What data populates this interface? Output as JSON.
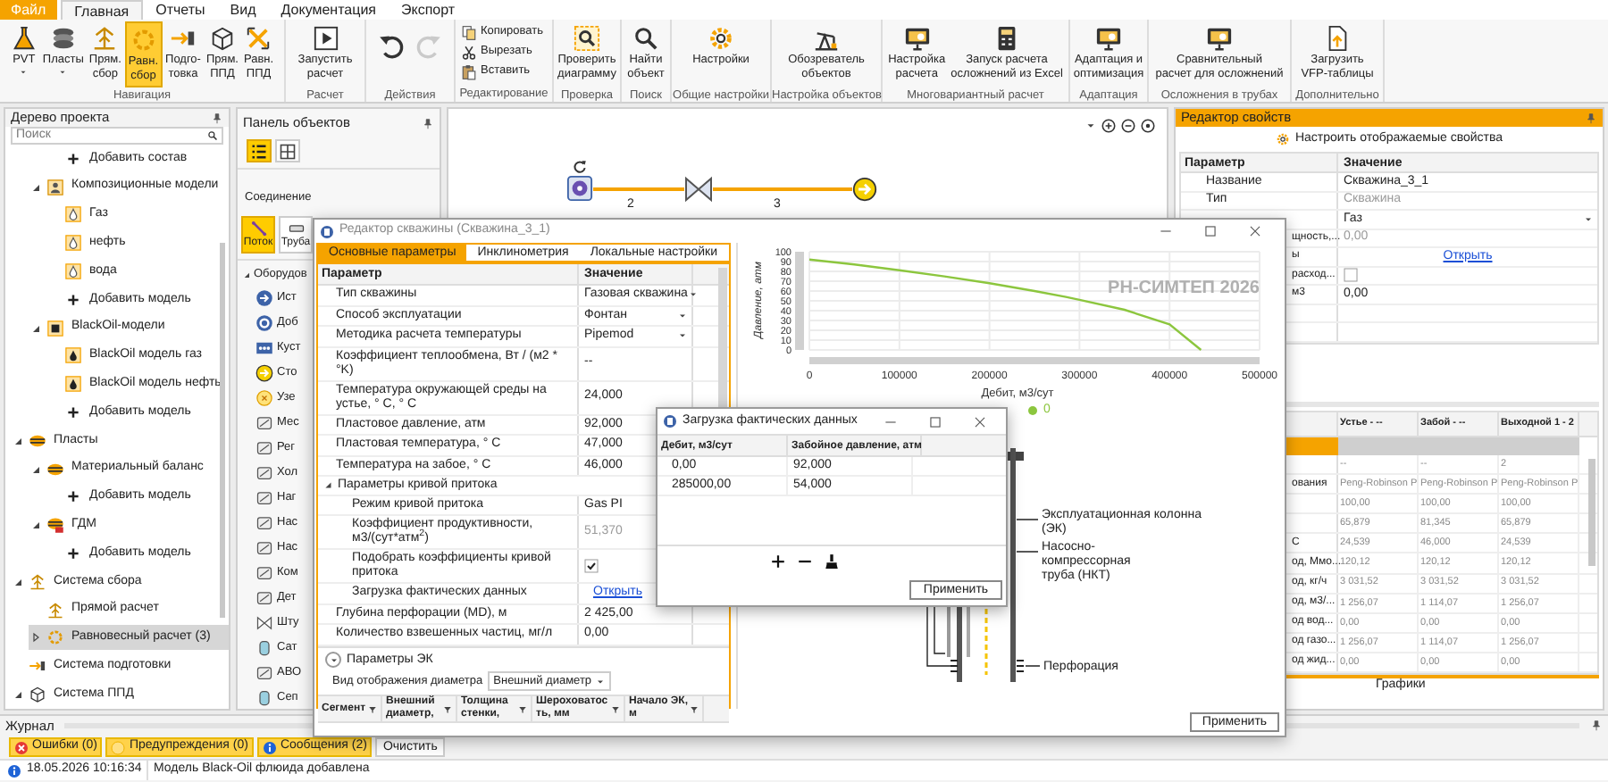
{
  "menu_tabs": [
    {
      "label": "Файл",
      "kind": "file",
      "selected": false
    },
    {
      "label": "Главная",
      "kind": "tab",
      "selected": true
    },
    {
      "label": "Отчеты",
      "kind": "tab",
      "selected": false
    },
    {
      "label": "Вид",
      "kind": "tab",
      "selected": false
    },
    {
      "label": "Документация",
      "kind": "tab",
      "selected": false
    },
    {
      "label": "Экспорт",
      "kind": "tab",
      "selected": false
    }
  ],
  "ribbon": [
    {
      "label": "Навигация",
      "kind": "large",
      "buttons": [
        {
          "label": "PVT",
          "kind": "flask",
          "dropdown": true,
          "selected": false
        },
        {
          "label": "Пласты",
          "kind": "layers",
          "dropdown": true,
          "selected": false
        },
        {
          "label": "Прям.\nсбор",
          "kind": "tower",
          "selected": false
        },
        {
          "label": "Равн.\nсбор",
          "kind": "ring",
          "selected": true
        },
        {
          "label": "Подго-\nтовка",
          "kind": "arrows",
          "selected": false
        },
        {
          "label": "Прям.\nППД",
          "kind": "cube",
          "selected": false
        },
        {
          "label": "Равн.\nППД",
          "kind": "cross",
          "selected": false
        }
      ]
    },
    {
      "label": "Расчет",
      "kind": "large",
      "buttons": [
        {
          "label": "Запустить\nрасчет",
          "kind": "play"
        }
      ]
    },
    {
      "label": "Действия",
      "kind": "large",
      "buttons": [
        {
          "kind": "undo",
          "disabled": false
        },
        {
          "kind": "redo",
          "disabled": true
        }
      ]
    },
    {
      "label": "Редактирование",
      "kind": "small",
      "buttons": [
        {
          "label": "Копировать",
          "kind": "copy"
        },
        {
          "label": "Вырезать",
          "kind": "cut"
        },
        {
          "label": "Вставить",
          "kind": "paste"
        }
      ]
    },
    {
      "label": "Проверка",
      "kind": "large",
      "buttons": [
        {
          "label": "Проверить\nдиаграмму",
          "kind": "check"
        }
      ]
    },
    {
      "label": "Поиск",
      "kind": "large",
      "buttons": [
        {
          "label": "Найти\nобъект",
          "kind": "search"
        }
      ]
    },
    {
      "label": "Общие настройки",
      "kind": "large",
      "buttons": [
        {
          "label": "Настройки",
          "kind": "gear"
        }
      ]
    },
    {
      "label": "Настройка объектов",
      "kind": "large",
      "buttons": [
        {
          "label": "Обозреватель\nобъектов",
          "kind": "rig"
        }
      ]
    },
    {
      "label": "Многовариантный расчет",
      "kind": "large",
      "buttons": [
        {
          "label": "Настройка\nрасчета",
          "kind": "monitor"
        },
        {
          "label": "Запуск расчета\nосложнений из Excel",
          "kind": "calc"
        }
      ]
    },
    {
      "label": "Адаптация",
      "kind": "large",
      "buttons": [
        {
          "label": "Адаптация и\nоптимизация",
          "kind": "monitor"
        }
      ]
    },
    {
      "label": "Осложнения в трубах",
      "kind": "large",
      "buttons": [
        {
          "label": "Сравнительный\nрасчет для осложнений",
          "kind": "monitor"
        }
      ]
    },
    {
      "label": "Дополнительно",
      "kind": "large",
      "buttons": [
        {
          "label": "Загрузить\nVFP-таблицы",
          "kind": "upload"
        }
      ]
    }
  ],
  "project_tree": {
    "title": "Дерево проекта",
    "search_placeholder": "Поиск",
    "items": [
      {
        "children": [
          {
            "children": [
              {
                "label": "Добавить состав",
                "kind": "add",
                "selected": false
              }
            ]
          },
          {
            "label": "Композиционные модели",
            "kind": "composition",
            "expanded": true,
            "selected": false,
            "children": [
              {
                "label": "Газ",
                "kind": "drop",
                "selected": false
              },
              {
                "label": "нефть",
                "kind": "drop",
                "selected": false
              },
              {
                "label": "вода",
                "kind": "drop",
                "selected": false
              },
              {
                "label": "Добавить модель",
                "kind": "add",
                "selected": false
              }
            ]
          },
          {
            "label": "BlackOil-модели",
            "kind": "blackoil",
            "expanded": true,
            "selected": false,
            "children": [
              {
                "label": "BlackOil модель газ",
                "kind": "oildrop",
                "selected": false
              },
              {
                "label": "BlackOil модель нефть",
                "kind": "oildrop",
                "selected": false
              },
              {
                "label": "Добавить модель",
                "kind": "add",
                "selected": false
              }
            ]
          }
        ]
      },
      {
        "label": "Пласты",
        "kind": "strata",
        "expanded": true,
        "selected": false,
        "children": [
          {
            "label": "Материальный баланс",
            "kind": "strata",
            "expanded": true,
            "selected": false,
            "children": [
              {
                "label": "Добавить модель",
                "kind": "add",
                "selected": false
              }
            ]
          },
          {
            "label": "ГДМ",
            "kind": "gdm",
            "expanded": true,
            "selected": false,
            "children": [
              {
                "label": "Добавить модель",
                "kind": "add",
                "selected": false
              }
            ]
          }
        ]
      },
      {
        "label": "Система сбора",
        "kind": "tower",
        "expanded": true,
        "selected": false,
        "children": [
          {
            "label": "Прямой расчет",
            "kind": "tower",
            "selected": false
          },
          {
            "label": "Равновесный расчет (3)",
            "kind": "ring",
            "expanded": false,
            "selected": true
          }
        ]
      },
      {
        "label": "Система подготовки",
        "kind": "arrows",
        "selected": false
      },
      {
        "label": "Система ППД",
        "kind": "cube",
        "expanded": true,
        "selected": false
      }
    ]
  },
  "objects_panel": {
    "title": "Панель объектов",
    "view_modes": [
      {
        "kind": "list",
        "selected": true
      },
      {
        "kind": "grid",
        "selected": false
      }
    ],
    "connection_label": "Соединение",
    "connections": [
      {
        "label": "Поток",
        "kind": "flow",
        "selected": true
      },
      {
        "label": "Труба",
        "kind": "pipe",
        "selected": false
      }
    ],
    "group": {
      "label": "Оборудов",
      "expanded": true
    },
    "items": [
      {
        "label": "Ист",
        "kind": "source"
      },
      {
        "label": "Доб",
        "kind": "target"
      },
      {
        "label": "Куст",
        "kind": "cluster"
      },
      {
        "label": "Сто",
        "kind": "sink"
      },
      {
        "label": "Узе",
        "kind": "node"
      },
      {
        "label": "Мес",
        "kind": "device"
      },
      {
        "label": "Рег",
        "kind": "device"
      },
      {
        "label": "Хол",
        "kind": "device"
      },
      {
        "label": "Наг",
        "kind": "device"
      },
      {
        "label": "Нас",
        "kind": "device"
      },
      {
        "label": "Нас",
        "kind": "device"
      },
      {
        "label": "Ком",
        "kind": "device"
      },
      {
        "label": "Дет",
        "kind": "device"
      },
      {
        "label": "Шту",
        "kind": "valve"
      },
      {
        "label": "Сат",
        "kind": "tank"
      },
      {
        "label": "АВО",
        "kind": "device"
      },
      {
        "label": "Сеп",
        "kind": "tank"
      }
    ]
  },
  "canvas": {
    "edges": [
      {
        "label": "2"
      },
      {
        "label": "3"
      }
    ]
  },
  "property_editor": {
    "title": "Редактор свойств",
    "configure": "Настроить отображаемые свойства",
    "columns": [
      "Параметр",
      "Значение"
    ],
    "rows": [
      {
        "label": "Название",
        "value": "Скважина_3_1",
        "kind": "text",
        "disabled": false
      },
      {
        "label": "Тип",
        "value": "Скважина",
        "kind": "text",
        "disabled": true
      },
      {
        "value": "Газ",
        "kind": "dropdown"
      },
      {
        "label": "щность,...",
        "value": "0,00",
        "kind": "text",
        "disabled": true
      },
      {
        "label": "ы",
        "value": "Открыть",
        "kind": "link"
      },
      {
        "label": "расход...",
        "kind": "check",
        "checked": false
      },
      {
        "label": "м3",
        "value": "0,00",
        "kind": "text",
        "disabled": false
      }
    ],
    "results_columns": [
      "Устье - --",
      "Забой - --",
      "Выходной 1 - 2"
    ],
    "results_rows": [
      {
        "cells": [
          "--",
          "--",
          "2"
        ]
      },
      {
        "label": "ования",
        "cells": [
          "Peng-Robinson P",
          "Peng-Robinson P",
          "Peng-Robinson P"
        ]
      },
      {
        "cells": [
          "100,00",
          "100,00",
          "100,00"
        ]
      },
      {
        "cells": [
          "65,879",
          "81,345",
          "65,879"
        ]
      },
      {
        "label": "С",
        "cells": [
          "24,539",
          "46,000",
          "24,539"
        ]
      },
      {
        "label": "од, Ммо...",
        "cells": [
          "120,12",
          "120,12",
          "120,12"
        ]
      },
      {
        "label": "од, кг/ч",
        "cells": [
          "3 031,52",
          "3 031,52",
          "3 031,52"
        ]
      },
      {
        "label": "од, м3/...",
        "cells": [
          "1 256,07",
          "1 114,07",
          "1 256,07"
        ]
      },
      {
        "label": "од вод...",
        "cells": [
          "0,00",
          "0,00",
          "0,00"
        ]
      },
      {
        "label": "од газо...",
        "cells": [
          "1 256,07",
          "1 114,07",
          "1 256,07"
        ]
      },
      {
        "label": "од жид...",
        "cells": [
          "0,00",
          "0,00",
          "0,00"
        ]
      }
    ],
    "bottom_tab": "Графики"
  },
  "journal": {
    "title": "Журнал",
    "filters": [
      {
        "label": "Ошибки (0)",
        "kind": "error",
        "on": true
      },
      {
        "label": "Предупреждения (0)",
        "kind": "warning",
        "on": true
      },
      {
        "label": "Сообщения (2)",
        "kind": "info",
        "on": true
      }
    ],
    "clear_button": "Очистить",
    "entries": [
      {
        "kind": "info",
        "time": "18.05.2026 10:16:34",
        "message": "Модель Black-Oil флюида добавлена"
      }
    ]
  },
  "well_editor": {
    "title": "Редактор скважины (Скважина_3_1)",
    "tabs": [
      {
        "label": "Основные параметры",
        "selected": true
      },
      {
        "label": "Инклинометрия",
        "selected": false
      },
      {
        "label": "Локальные настройки",
        "selected": false
      }
    ],
    "columns": [
      "Параметр",
      "Значение"
    ],
    "params": [
      {
        "label": "Тип скважины",
        "value": "Газовая скважина",
        "kind": "dropdown"
      },
      {
        "label": "Способ эксплуатации",
        "value": "Фонтан",
        "kind": "dropdown"
      },
      {
        "label": "Методика расчета температуры",
        "value": "Pipemod",
        "kind": "dropdown"
      },
      {
        "label": "Коэффициент теплообмена, Вт / (м2 * °K)",
        "value": "--",
        "kind": "text",
        "disabled": false
      },
      {
        "label": "Температура окружающей среды на устье, ° С, ° С",
        "value": "24,000",
        "kind": "text",
        "disabled": false
      },
      {
        "label": "Пластовое давление, атм",
        "value": "92,000",
        "kind": "text",
        "disabled": false
      },
      {
        "label": "Пластовая температура, ° С",
        "value": "47,000",
        "kind": "text",
        "disabled": false
      },
      {
        "label": "Температура на забое, ° С",
        "value": "46,000",
        "kind": "text",
        "disabled": false
      },
      {
        "label": "Параметры кривой притока",
        "kind": "group",
        "expanded": true,
        "children": [
          {
            "label": "Режим кривой притока",
            "value": "Gas PI",
            "kind": "text",
            "disabled": false
          },
          {
            "label": "Коэффициент продуктивности, м3/(сут*атм$^{2}$)",
            "value": "51,370",
            "kind": "text",
            "disabled": true
          },
          {
            "label": "Подобрать коэффициенты кривой притока",
            "kind": "check",
            "checked": true
          },
          {
            "label": "Загрузка фактических данных",
            "value": "Открыть",
            "kind": "link"
          }
        ]
      },
      {
        "label": "Глубина перфорации (MD), м",
        "value": "2 425,00",
        "kind": "text",
        "disabled": false
      },
      {
        "label": "Количество взвешенных частиц, мг/л",
        "value": "0,00",
        "kind": "text",
        "disabled": false
      }
    ],
    "ek_section": {
      "label": "Параметры ЭК",
      "expanded": false
    },
    "diameter_view": {
      "label": "Вид отображения диаметра",
      "value": "Внешний диаметр"
    },
    "segment_columns": [
      "Сегмент",
      "Внешний диаметр,",
      "Толщина стенки,",
      "Шероховатость, мм",
      "Начало ЭК, м"
    ],
    "chart_data": {
      "type": "line",
      "xlabel": "Дебит, м3/сут",
      "ylabel": "Давление, атм",
      "x": [
        0,
        50000,
        100000,
        150000,
        200000,
        250000,
        285000,
        300000,
        350000,
        400000,
        435000
      ],
      "series": [
        {
          "name": "0",
          "color": "#8cc63e",
          "values": [
            92,
            87,
            81,
            75,
            68,
            60,
            54,
            51,
            41,
            26,
            0
          ]
        }
      ],
      "grid": true,
      "xlim": [
        0,
        500000
      ],
      "ylim": [
        0,
        100
      ],
      "xticks": [
        0,
        100000,
        200000,
        300000,
        400000,
        500000
      ],
      "yticks": [
        0,
        10,
        20,
        30,
        40,
        50,
        60,
        70,
        80,
        90,
        100
      ]
    },
    "chart_watermark": "РН-СИМТЕП 2026",
    "schematic_labels": [
      "Эксплуатационная колонна (ЭК)",
      "Насосно-компрессорная труба (НКТ)",
      "Перфорация"
    ],
    "apply_button": "Применить"
  },
  "data_dialog": {
    "title": "Загрузка фактических данных",
    "columns": [
      "Дебит, м3/сут",
      "Забойное давление, атм"
    ],
    "rows": [
      [
        "0,00",
        "92,000"
      ],
      [
        "285000,00",
        "54,000"
      ]
    ],
    "apply_button": "Применить"
  }
}
